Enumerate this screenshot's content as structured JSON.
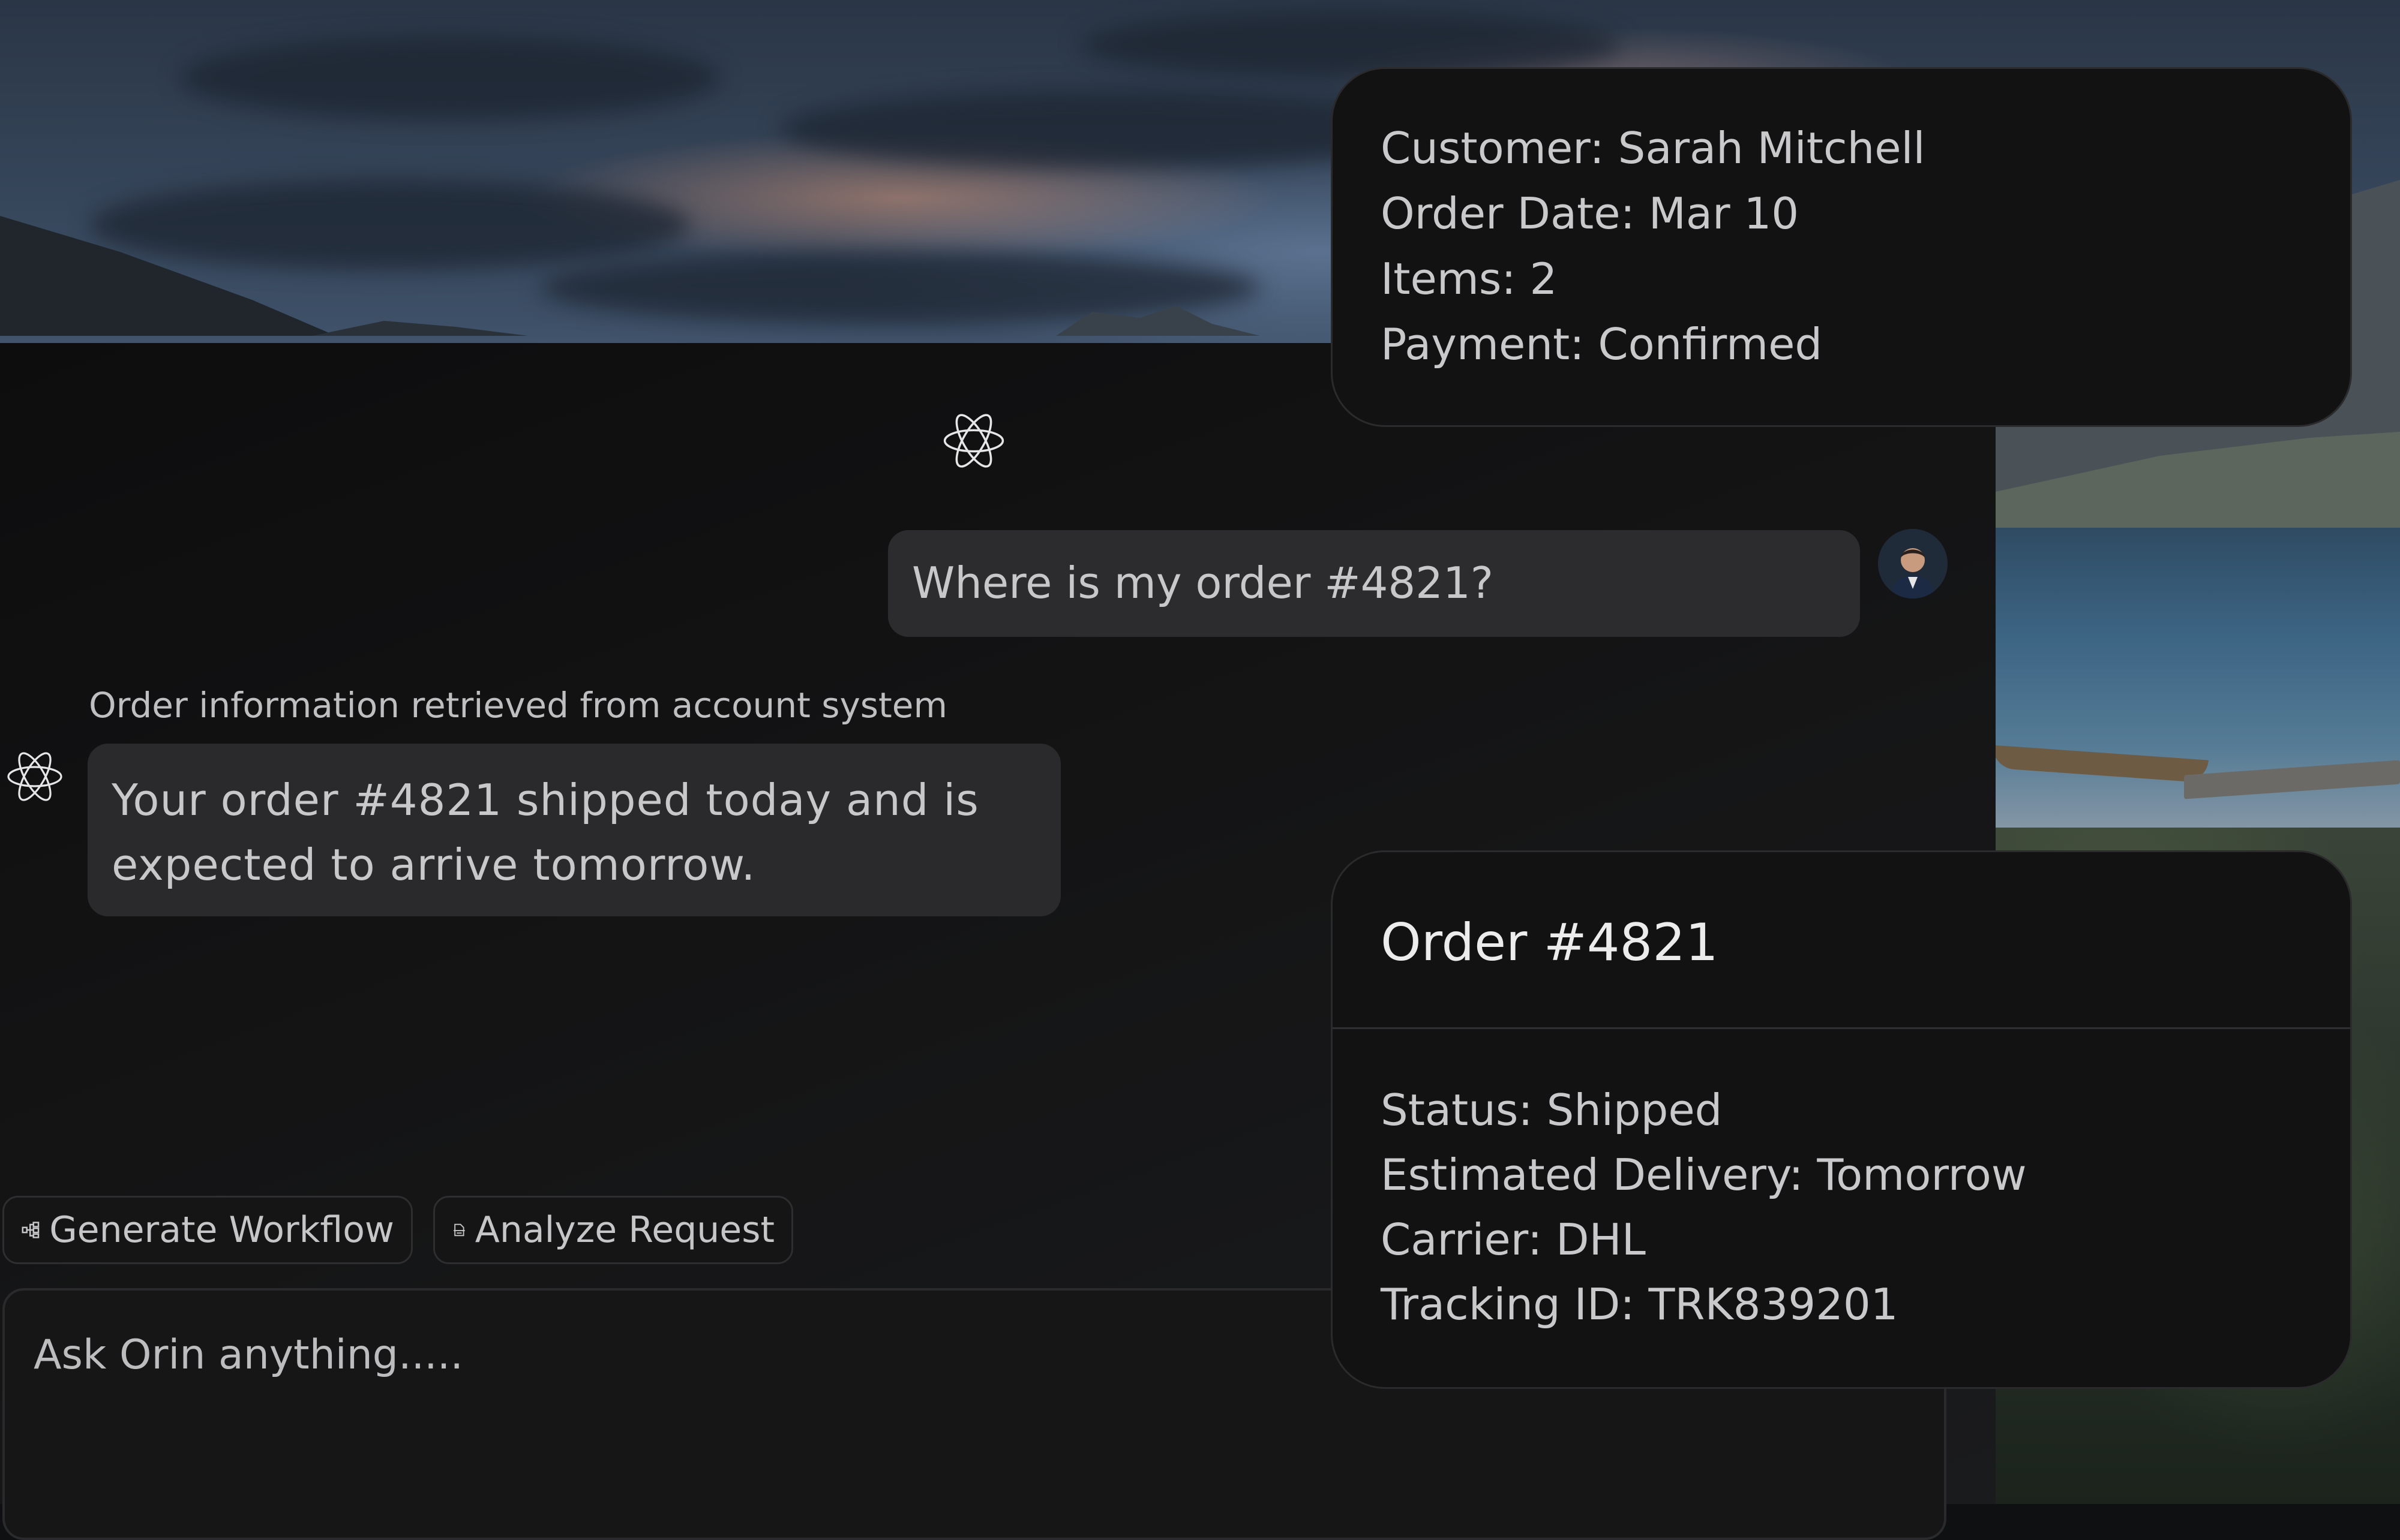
{
  "colors": {
    "panel_bg": "#141415",
    "bubble_user": "#2c2c2e",
    "bubble_ai": "#2a2a2c",
    "card_bg": "#121213",
    "text": "#c9c9cb"
  },
  "chat": {
    "assistant_logo_icon": "atom-orbit-icon",
    "messages": {
      "user": {
        "text": "Where is my order #4821?",
        "avatar_icon": "user-avatar-photo"
      },
      "assistant": {
        "source_note": "Order information retrieved from account system",
        "text": "Your order #4821 shipped today and is expected to arrive tomorrow.",
        "avatar_icon": "atom-orbit-icon"
      }
    },
    "actions": [
      {
        "label": "Generate Workflow",
        "icon": "workflow-icon"
      },
      {
        "label": "Analyze Request",
        "icon": "document-scan-icon"
      }
    ],
    "composer": {
      "placeholder": "Ask Orin anything....."
    }
  },
  "customer_card": {
    "rows": [
      "Customer: Sarah Mitchell",
      "Order Date: Mar 10",
      "Items: 2",
      "Payment: Confirmed"
    ]
  },
  "order_card": {
    "title": "Order #4821",
    "rows": [
      "Status: Shipped",
      "Estimated Delivery: Tomorrow",
      "Carrier: DHL",
      "Tracking ID: TRK839201"
    ]
  }
}
